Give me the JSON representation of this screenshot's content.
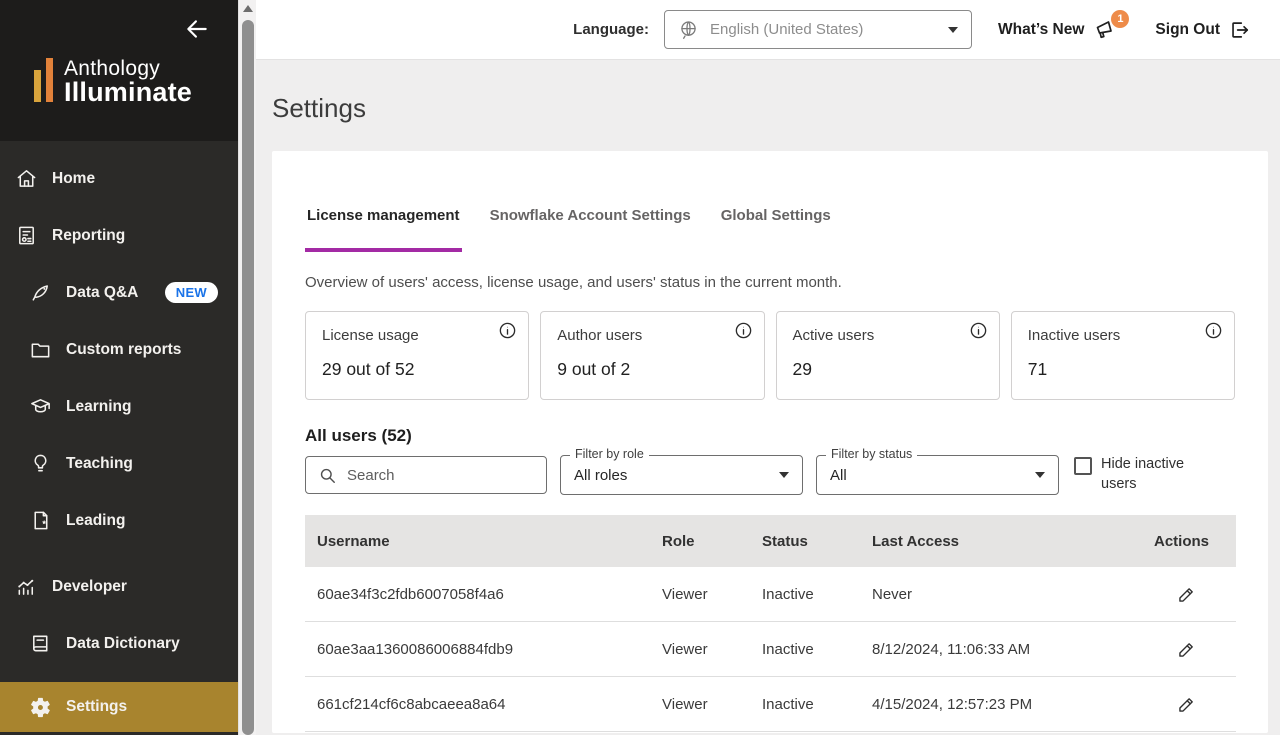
{
  "topbar": {
    "language_label": "Language:",
    "language_value": "English (United States)",
    "whats_new_label": "What’s New",
    "whats_new_badge": "1",
    "sign_out_label": "Sign Out"
  },
  "sidebar": {
    "brand_line1": "Anthology",
    "brand_line2": "Illuminate",
    "items": [
      {
        "label": "Home"
      },
      {
        "label": "Reporting"
      },
      {
        "label": "Data Q&A",
        "badge": "NEW"
      },
      {
        "label": "Custom reports"
      },
      {
        "label": "Learning"
      },
      {
        "label": "Teaching"
      },
      {
        "label": "Leading"
      },
      {
        "label": "Developer"
      },
      {
        "label": "Data Dictionary"
      },
      {
        "label": "Settings",
        "active": true
      }
    ]
  },
  "page": {
    "title": "Settings"
  },
  "tabs": [
    {
      "label": "License management",
      "active": true
    },
    {
      "label": "Snowflake Account Settings",
      "active": false
    },
    {
      "label": "Global Settings",
      "active": false
    }
  ],
  "overview_text": "Overview of users' access, license usage, and users' status in the current month.",
  "stats": [
    {
      "label": "License usage",
      "value": "29 out of 52"
    },
    {
      "label": "Author users",
      "value": "9 out of 2"
    },
    {
      "label": "Active users",
      "value": "29"
    },
    {
      "label": "Inactive users",
      "value": "71"
    }
  ],
  "users": {
    "heading": "All users (52)",
    "search_placeholder": "Search",
    "filter_role_label": "Filter by role",
    "filter_role_value": "All roles",
    "filter_status_label": "Filter by status",
    "filter_status_value": "All",
    "hide_inactive_label": "Hide inactive users",
    "columns": [
      "Username",
      "Role",
      "Status",
      "Last Access",
      "Actions"
    ],
    "rows": [
      {
        "username": "60ae34f3c2fdb6007058f4a6",
        "role": "Viewer",
        "status": "Inactive",
        "last_access": "Never"
      },
      {
        "username": "60ae3aa1360086006884fdb9",
        "role": "Viewer",
        "status": "Inactive",
        "last_access": "8/12/2024, 11:06:33 AM"
      },
      {
        "username": "661cf214cf6c8abcaeea8a64",
        "role": "Viewer",
        "status": "Inactive",
        "last_access": "4/15/2024, 12:57:23 PM"
      }
    ]
  },
  "colors": {
    "sidebar_active": "#a8842e",
    "tab_underline": "#a32aa4",
    "notification_badge": "#ee8b49",
    "new_badge_text": "#1a73e8",
    "logo_bar_left": "#d9a43c",
    "logo_bar_right": "#e2823a"
  }
}
